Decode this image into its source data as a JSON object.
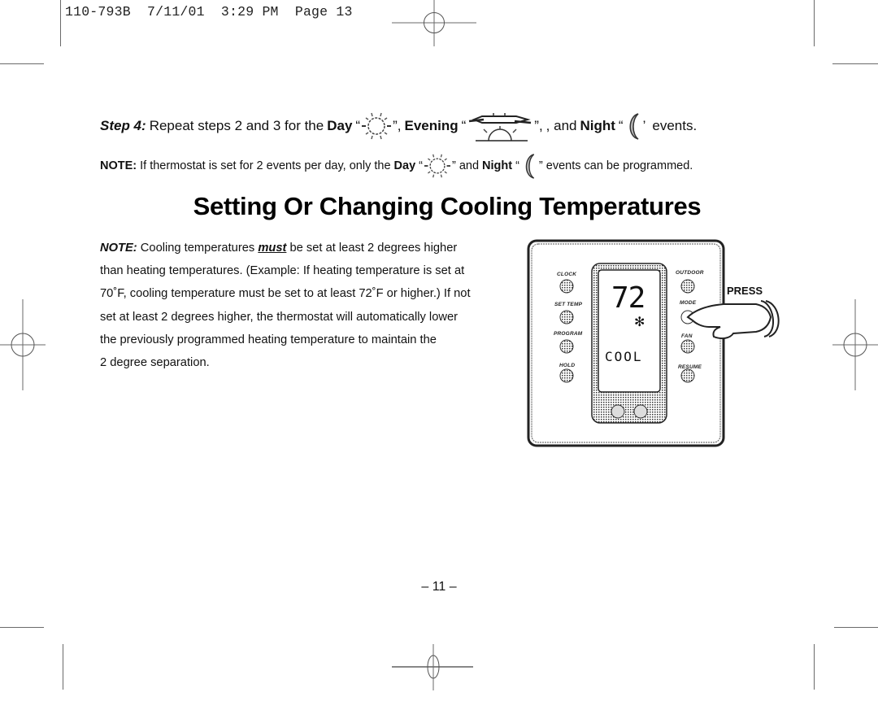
{
  "header": {
    "slug": "110-793B  7/11/01  3:29 PM  Page 13"
  },
  "step4": {
    "label": "Step 4:",
    "text_a": "Repeat steps 2 and 3 for the",
    "day": "Day",
    "open_q": "“",
    "close_q_comma": "”,",
    "evening": "Evening",
    "and": ", and",
    "night": "Night",
    "close_q_tick": "’",
    "events": "events.",
    "icons": [
      "day-sun-icon",
      "evening-sunset-icon",
      "night-moon-icon"
    ]
  },
  "note1": {
    "label": "NOTE:",
    "text_a": "If thermostat is set for 2 events per day, only the",
    "day": "Day",
    "open_q": "“",
    "close_q": "”",
    "and": "and",
    "night": "Night",
    "text_b": "events can be programmed."
  },
  "section_title": "Setting Or Changing Cooling Temperatures",
  "note2": {
    "label": "NOTE:",
    "line1_a": "Cooling temperatures",
    "must": "must",
    "line1_b": "be set at least 2 degrees higher",
    "line2": "than heating temperatures. (Example: If heating temperature is set at",
    "line3": "70˚F, cooling temperature must be set to at least 72˚F or higher.) If not",
    "line4": "set at least 2 degrees higher, the thermostat will automatically lower",
    "line5": "the previously programmed heating temperature to maintain the",
    "line6": "2 degree separation."
  },
  "thermostat": {
    "display_temp": "72",
    "display_mode": "COOL",
    "mode_icon": "snowflake-icon",
    "left_buttons": [
      "CLOCK",
      "SET TEMP",
      "PROGRAM",
      "HOLD"
    ],
    "right_buttons": [
      "OUTDOOR",
      "MODE",
      "FAN",
      "RESUME"
    ],
    "pressed_button": "MODE",
    "press_label": "PRESS"
  },
  "page_number": "– 11 –"
}
